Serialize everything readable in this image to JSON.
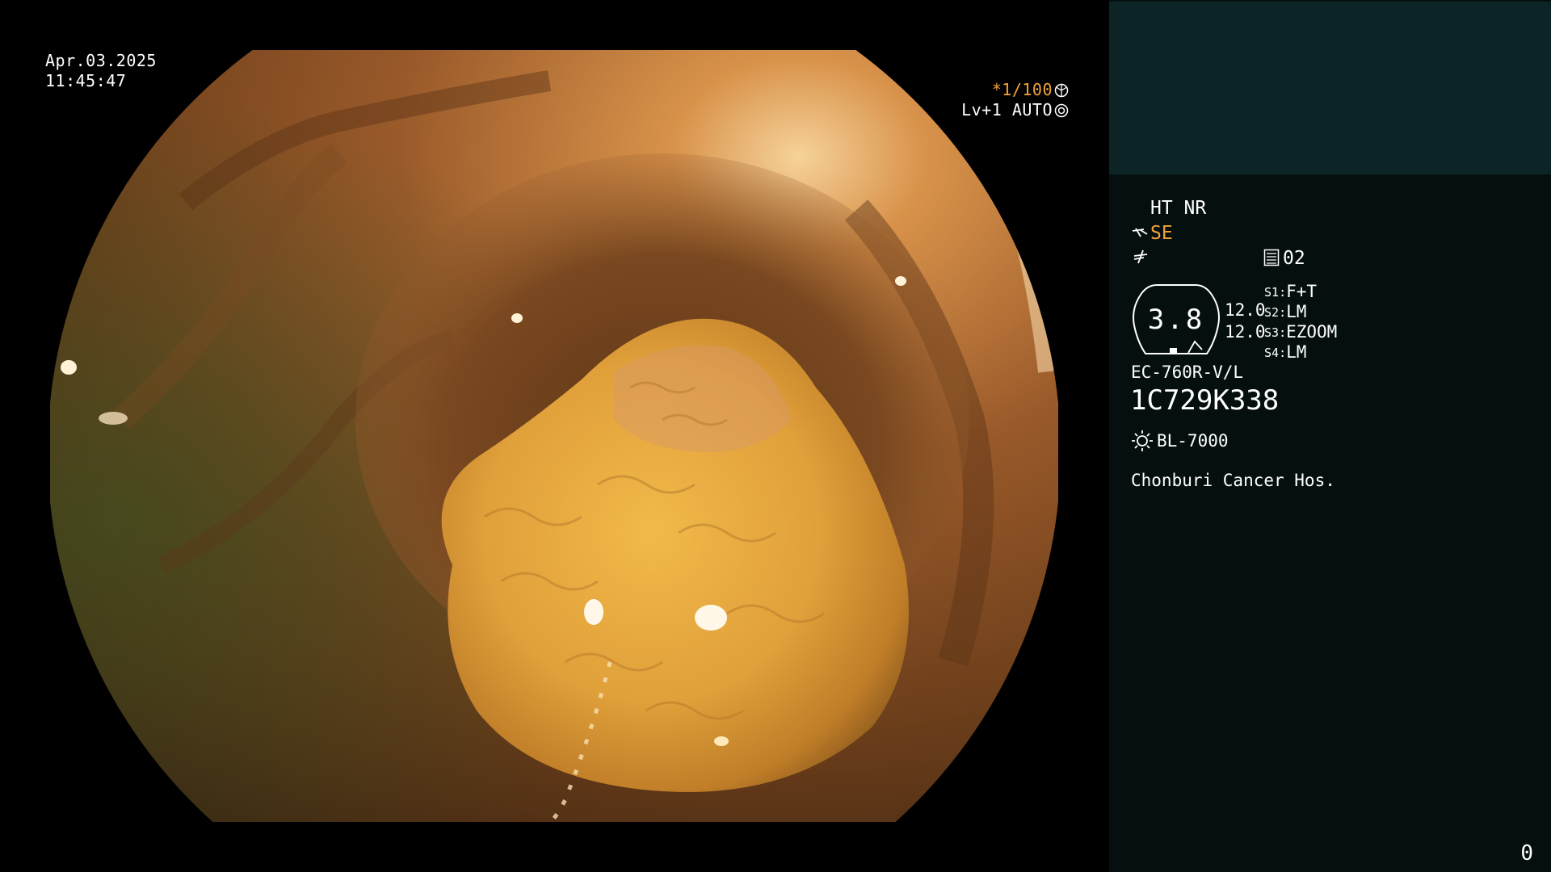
{
  "osd": {
    "date": "Apr.03.2025",
    "time": "11:45:47",
    "shutter": "*1/100",
    "light_level": "Lv+1 AUTO"
  },
  "panel": {
    "ht_nr": "HT NR",
    "se": "SE",
    "mode_number": "02",
    "zoom_value": "3.8",
    "value_1": "12.0",
    "value_2": "12.0",
    "switches": [
      {
        "key": "S1",
        "value": "F+T"
      },
      {
        "key": "S2",
        "value": "LM"
      },
      {
        "key": "S3",
        "value": "EZOOM"
      },
      {
        "key": "S4",
        "value": "LM"
      }
    ],
    "scope_model": "EC-760R-V/L",
    "scope_serial": "1C729K338",
    "light_source": "BL-7000",
    "hospital": "Chonburi Cancer Hos.",
    "page_number": "0"
  },
  "colors": {
    "accent_orange": "#f2a33a",
    "panel_top": "#0d2426",
    "panel_bg": "#060f10"
  },
  "icons": {
    "shutter": "aperture-icon",
    "auto": "iris-icon",
    "scope": "scope-angle-icon",
    "enhance": "enhance-icon",
    "mode": "memory-icon",
    "light": "sun-icon"
  }
}
